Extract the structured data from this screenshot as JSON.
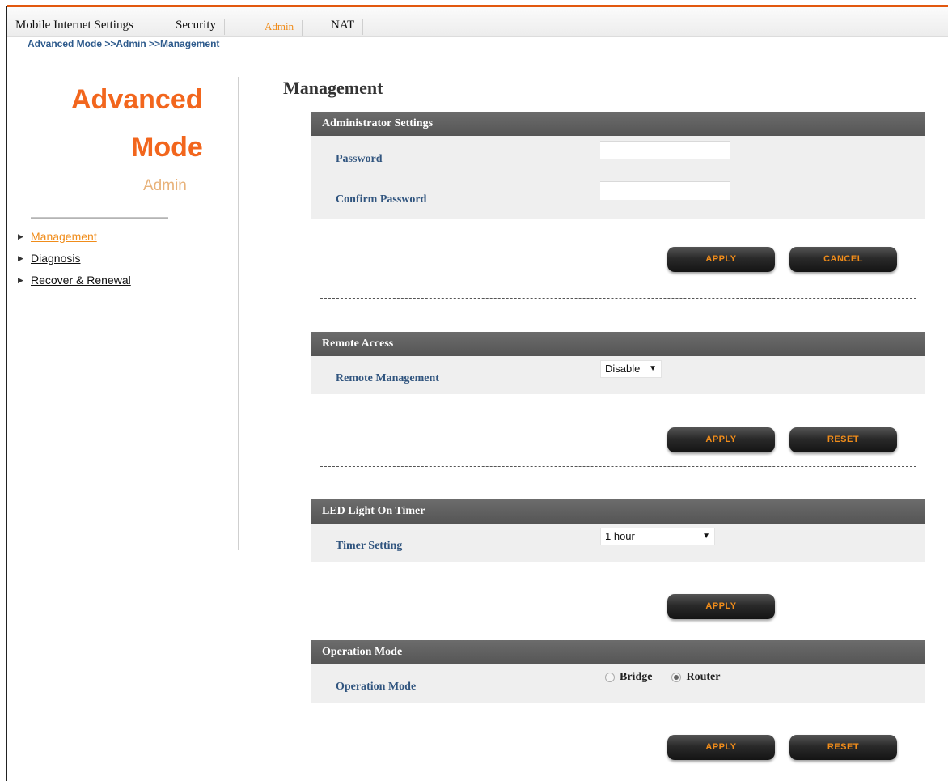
{
  "nav": {
    "tabs": [
      {
        "label": "Mobile Internet Settings",
        "active": false
      },
      {
        "label": "Security",
        "active": false
      },
      {
        "label": "Admin",
        "active": true
      },
      {
        "label": "NAT",
        "active": false
      }
    ]
  },
  "breadcrumb": "Advanced Mode >>Admin >>Management",
  "sidebar": {
    "title_line1": "Advanced",
    "title_line2": "Mode",
    "subtitle": "Admin",
    "items": [
      {
        "label": "Management",
        "active": true
      },
      {
        "label": "Diagnosis",
        "active": false
      },
      {
        "label": "Recover & Renewal",
        "active": false
      }
    ]
  },
  "page_title": "Management",
  "admin_settings": {
    "header": "Administrator Settings",
    "password_label": "Password",
    "password_value": "",
    "confirm_label": "Confirm Password",
    "confirm_value": "",
    "apply_label": "APPLY",
    "cancel_label": "CANCEL"
  },
  "remote_access": {
    "header": "Remote Access",
    "remote_mgmt_label": "Remote Management",
    "remote_mgmt_value": "Disable",
    "apply_label": "APPLY",
    "reset_label": "RESET"
  },
  "led_timer": {
    "header": "LED Light On Timer",
    "timer_label": "Timer Setting",
    "timer_value": "1 hour",
    "apply_label": "APPLY"
  },
  "operation_mode": {
    "header": "Operation Mode",
    "mode_label": "Operation Mode",
    "options": [
      {
        "label": "Bridge",
        "selected": false
      },
      {
        "label": "Router",
        "selected": true
      }
    ],
    "apply_label": "APPLY",
    "reset_label": "RESET"
  },
  "colors": {
    "accent": "#f2661d",
    "active_tab": "#f08c1a",
    "section_header": "#5d5d5d",
    "field_label": "#31557f",
    "button_text": "#f08c1a"
  },
  "icons": {
    "sidebar_bullet": "triangle-right-icon",
    "select_arrow": "chevron-down-icon"
  }
}
